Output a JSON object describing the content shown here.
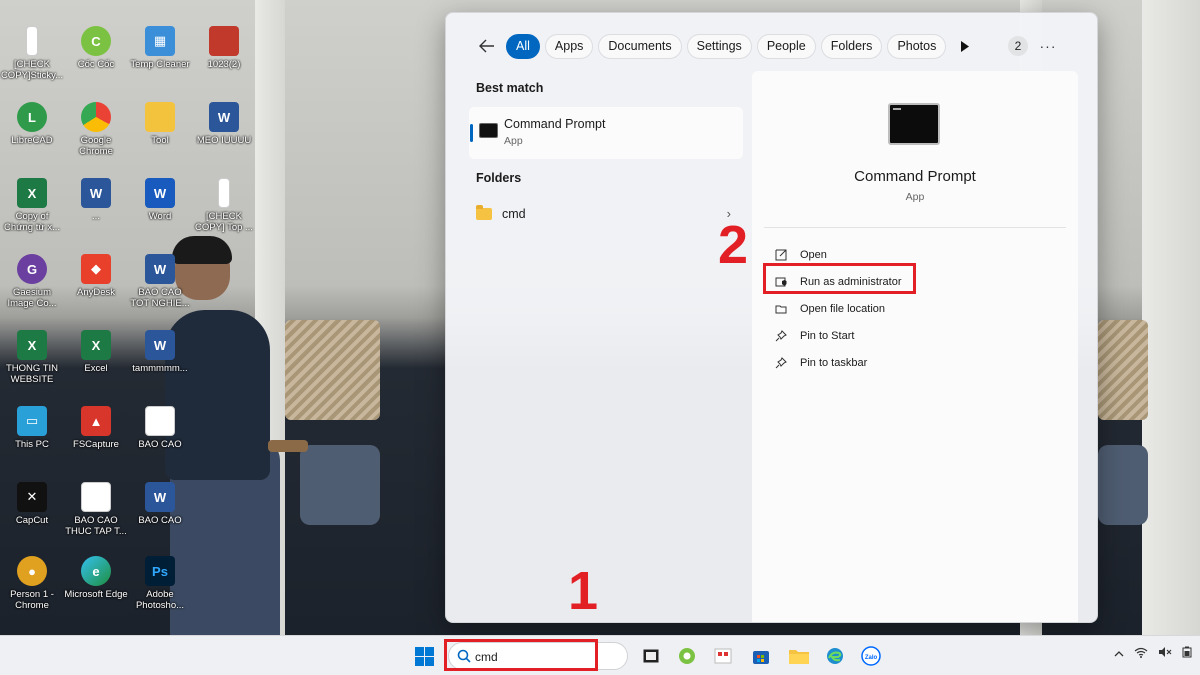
{
  "desktop": {
    "icons": [
      {
        "label": "[CHECK COPY]Sticky...",
        "icon": "document-icon"
      },
      {
        "label": "Cốc Cốc",
        "icon": "coccoc-icon"
      },
      {
        "label": "Temp Cleaner",
        "icon": "temp-cleaner-icon"
      },
      {
        "label": "1023(2)",
        "icon": "image-icon"
      },
      {
        "label": "LibreCAD",
        "icon": "librecad-icon"
      },
      {
        "label": "Google Chrome",
        "icon": "chrome-icon"
      },
      {
        "label": "Tool",
        "icon": "folder-icon"
      },
      {
        "label": "MEO IUUUU",
        "icon": "word-doc-icon"
      },
      {
        "label": "Copy of Chứng từ x...",
        "icon": "excel-icon"
      },
      {
        "label": "...",
        "icon": "word-doc-icon"
      },
      {
        "label": "Word",
        "icon": "word-icon"
      },
      {
        "label": "[CHECK COPY] Top ...",
        "icon": "document-icon"
      },
      {
        "label": "Gaesium Image Co...",
        "icon": "gaesium-icon"
      },
      {
        "label": "AnyDesk",
        "icon": "anydesk-icon"
      },
      {
        "label": "BAO CAO TOT NGHIE...",
        "icon": "word-doc-icon"
      },
      {
        "label": "THONG TIN WEBSITE",
        "icon": "excel-icon"
      },
      {
        "label": "Excel",
        "icon": "excel-icon"
      },
      {
        "label": "tammmmm...",
        "icon": "word-doc-icon"
      },
      {
        "label": "This PC",
        "icon": "monitor-icon"
      },
      {
        "label": "FSCapture",
        "icon": "fscapture-icon"
      },
      {
        "label": "BAO CAO",
        "icon": "document-icon"
      },
      {
        "label": "CapCut",
        "icon": "capcut-icon"
      },
      {
        "label": "BAO CAO THUC TAP T...",
        "icon": "document-icon"
      },
      {
        "label": "BAO CAO",
        "icon": "word-doc-icon"
      },
      {
        "label": "Person 1 - Chrome",
        "icon": "chrome-icon"
      },
      {
        "label": "Microsoft Edge",
        "icon": "edge-icon"
      },
      {
        "label": "Adobe Photosho...",
        "icon": "photoshop-icon"
      }
    ]
  },
  "search_panel": {
    "filters": [
      "All",
      "Apps",
      "Documents",
      "Settings",
      "People",
      "Folders",
      "Photos"
    ],
    "active_filter": "All",
    "badge_count": "2",
    "best_match_label": "Best match",
    "best_match": {
      "title": "Command Prompt",
      "subtitle": "App"
    },
    "folders_label": "Folders",
    "folder_result": "cmd",
    "detail": {
      "title": "Command Prompt",
      "subtitle": "App",
      "actions": [
        {
          "label": "Open",
          "icon": "open-icon"
        },
        {
          "label": "Run as administrator",
          "icon": "shield-icon"
        },
        {
          "label": "Open file location",
          "icon": "folder-open-icon"
        },
        {
          "label": "Pin to Start",
          "icon": "pin-icon"
        },
        {
          "label": "Pin to taskbar",
          "icon": "pin-icon"
        }
      ]
    }
  },
  "annotations": {
    "step1": "1",
    "step2": "2"
  },
  "taskbar": {
    "search_value": "cmd",
    "accent": "#0067c0"
  },
  "colors": {
    "annotation_red": "#e31f26",
    "accent": "#0067c0"
  }
}
